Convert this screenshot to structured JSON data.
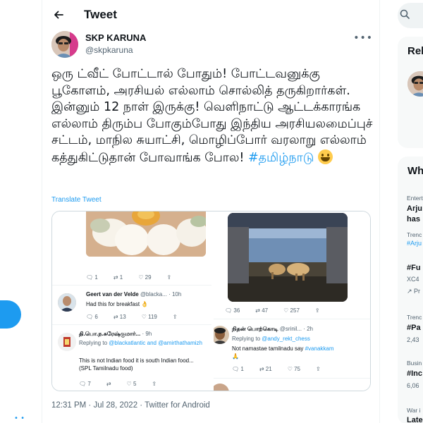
{
  "header": {
    "title": "Tweet"
  },
  "author": {
    "name": "SKP KARUNA",
    "handle": "@skpkaruna"
  },
  "tweet": {
    "text": "ஒரு ட்வீட் போட்டால் போதும்! போட்டவனுக்கு பூகோளம், அரசியல் எல்லாம் சொல்லித் தருகிறார்கள். இன்னும் 12 நாள் இருக்கு! வெளிநாட்டு ஆட்டக்காரங்க எல்லாம் திரும்ப போகும்போது இந்திய அரசியலமைப்புச் சட்டம், மாநில சுயாட்சி, மொழிப்போர் வரலாறு எல்லாம் கத்துகிட்டுதான் போவாங்க போல! ",
    "hashtag": "#தமிழ்நாடு",
    "translate": "Translate Tweet",
    "meta": "12:31 PM · Jul 28, 2022 · Twitter for Android"
  },
  "media_left": {
    "stats_top": {
      "replies": "1",
      "retweets": "1",
      "likes": "29"
    },
    "reply1": {
      "name": "Geert van der Velde",
      "meta": "@blacka... · 10h",
      "text": "Had this for breakfast 👌",
      "replies": "6",
      "retweets": "13",
      "likes": "119"
    },
    "reply2": {
      "name": "தி.பொ.ந.சுரேஷ்குமார்...",
      "meta": "· 9h",
      "replying_prefix": "Replying to ",
      "replying_to": "@blackatlantic and @amirthathamizh",
      "text": "This is not Indian food it is south Indian food...(SPL Tamilnadu food)",
      "replies": "7",
      "retweets": "",
      "likes": "5"
    }
  },
  "media_right": {
    "stats": {
      "replies": "36",
      "retweets": "47",
      "likes": "257"
    },
    "reply1": {
      "name": "நிதன் பொற்கொடி",
      "meta": "@srinil... · 2h",
      "replying_prefix": "Replying to ",
      "replying_to": "@andy_rekt_chess",
      "text": "Not namastae tamilnadu say ",
      "hashtag": "#vanakkam",
      "replies": "1",
      "retweets": "21",
      "likes": "75"
    }
  },
  "sidebar": {
    "relevant_title": "Rel",
    "whats_title": "Wh",
    "trends": [
      {
        "category": "Entert",
        "name": "Arju",
        "extra": "has"
      },
      {
        "category": "Trenc",
        "name": "#Arju",
        "extra": ""
      },
      {
        "category": "",
        "name": "#Fu",
        "extra": "XC4"
      },
      {
        "category": "",
        "name": "",
        "extra": "Pr"
      },
      {
        "category": "Trenc",
        "name": "#Pa",
        "extra": "2,43"
      },
      {
        "category": "Busin",
        "name": "#Inc",
        "extra": "6,06"
      },
      {
        "category": "War i",
        "name": "Late",
        "extra": ""
      }
    ]
  },
  "colors": {
    "accent": "#1d9bf0",
    "text": "#0f1419",
    "muted": "#536471",
    "border": "#cfd9de"
  }
}
